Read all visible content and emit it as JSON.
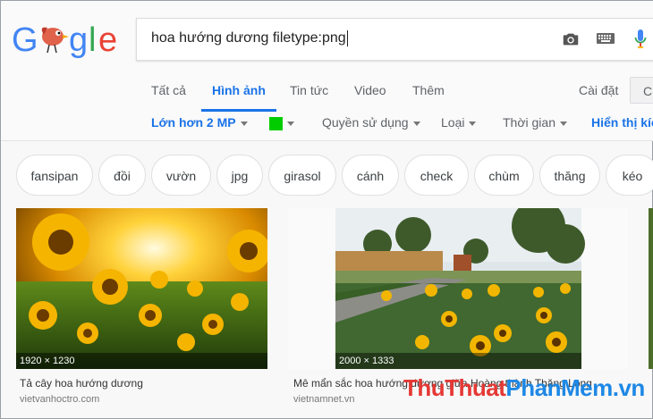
{
  "logo": {
    "text": "Google"
  },
  "search": {
    "query": "hoa hướng dương filetype:png"
  },
  "icons": {
    "camera": "camera-icon",
    "keyboard": "keyboard-icon",
    "mic": "mic-icon"
  },
  "tabs": [
    {
      "label": "Tất cả"
    },
    {
      "label": "Hình ảnh",
      "active": true
    },
    {
      "label": "Tin tức"
    },
    {
      "label": "Video"
    },
    {
      "label": "Thêm"
    }
  ],
  "settings_label": "Cài đặt",
  "tools_label": "C",
  "filters": {
    "size": "Lớn hơn 2 MP",
    "color_hex": "#00cc00",
    "rights": "Quyền sử dụng",
    "type": "Loại",
    "time": "Thời gian",
    "show_sizes": "Hiển thị kíc"
  },
  "chips": [
    "fansipan",
    "đồi",
    "vườn",
    "jpg",
    "girasol",
    "cánh",
    "check",
    "chùm",
    "thăng",
    "kéo"
  ],
  "results": [
    {
      "dims": "1920 × 1230",
      "title": "Tả cây hoa hướng dương",
      "source": "vietvanhoctro.com"
    },
    {
      "dims": "2000 × 1333",
      "title": "Mê mẩn sắc hoa hướng dương giữa Hoàng thành Thăng Long",
      "source": "vietnamnet.vn"
    }
  ],
  "watermark": {
    "part1": "ThuThuat",
    "part2": "PhanMem",
    "part3": ".vn"
  },
  "colors": {
    "accent": "#1a73e8",
    "watermark_red": "#e53935",
    "watermark_blue": "#1e88e5"
  }
}
